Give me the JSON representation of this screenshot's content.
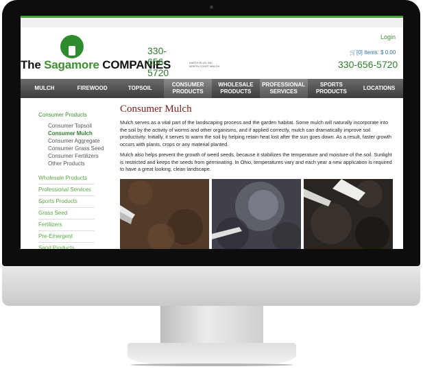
{
  "header": {
    "logo": {
      "the": "The",
      "sagamore": "Sagamore",
      "companies": "COMPANIES",
      "sub": "EARTH PLUS, INC. NORTH COAST MULCH"
    },
    "logo_phone": "330-656-5720",
    "login": "Login",
    "cart": "[0] Items: $ 0.00",
    "phone": "330-656-5720"
  },
  "nav": [
    {
      "label": "MULCH"
    },
    {
      "label": "FIREWOOD"
    },
    {
      "label": "TOPSOIL"
    },
    {
      "label": "CONSUMER PRODUCTS"
    },
    {
      "label": "WHOLESALE PRODUCTS"
    },
    {
      "label": "PROFESSIONAL SERVICES"
    },
    {
      "label": "SPORTS PRODUCTS"
    },
    {
      "label": "LOCATIONS"
    }
  ],
  "sidebar": {
    "heading": "Consumer Products",
    "subitems": [
      "Consumer Topsoil",
      "Consumer Mulch",
      "Consumer Aggregate",
      "Consumer Grass Seed",
      "Consumer Fertilizers",
      "Other Products"
    ],
    "categories": [
      "Wholesale Products",
      "Professional Services",
      "Sports Products",
      "Grass Seed",
      "Fertilizers",
      "Pre-Emergent",
      "Sand Products"
    ]
  },
  "content": {
    "title": "Consumer Mulch",
    "para1": "Mulch serves as a vital part of the landscaping process and the garden habitat. Some mulch will naturally incorporate into the soil by the activity of worms and other organisms, and if applied correctly, mulch can dramatically improve soil productivity. Initially, it serves to warm the soil by helping retain heat lost after the sun goes down. As a result, faster growth occurs with plants, crops or any material planted.",
    "para2": "Mulch also helps prevent the growth of weed seeds, because it stabilizes the temperature and moisture of the soil. Sunlight is restricted and keeps the seeds from germinating. In Ohio, temperatures vary and each year a new application is required to have a great looking, clean landscape."
  },
  "colors": {
    "brand_green": "#3d8f2f",
    "title_red": "#7a2222",
    "nav_bg": "#4a4a4a"
  }
}
